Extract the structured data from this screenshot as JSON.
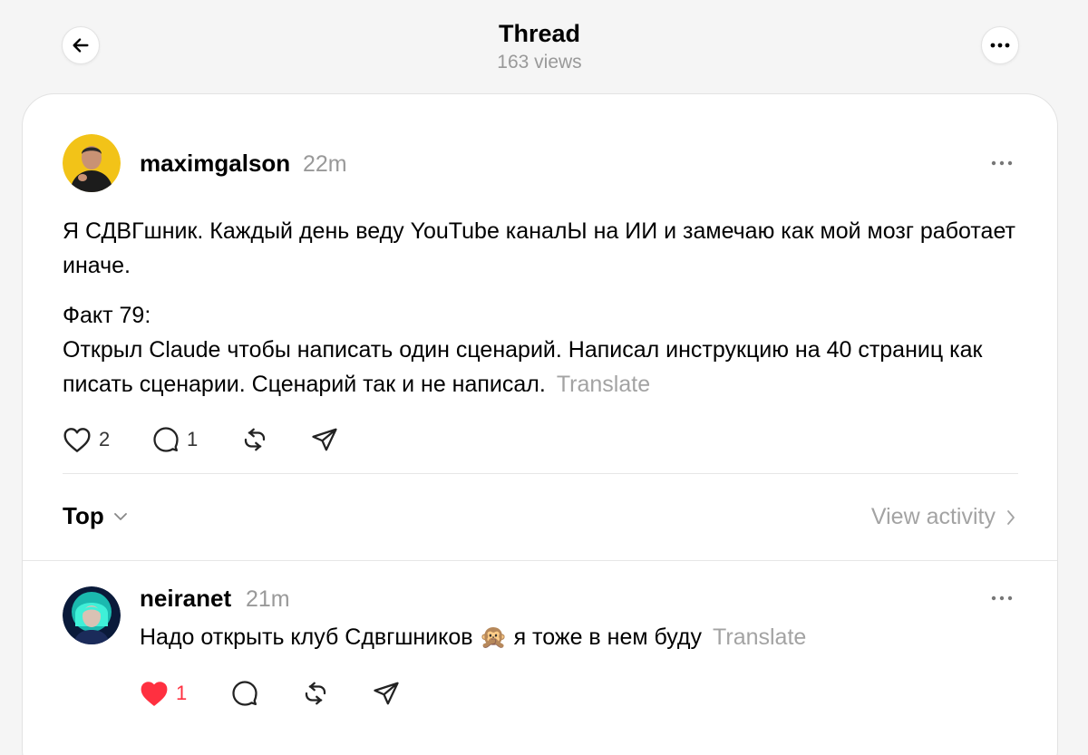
{
  "header": {
    "title": "Thread",
    "views": "163 views"
  },
  "post": {
    "username": "maximgalson",
    "time": "22m",
    "paragraph1": "Я СДВГшник. Каждый день веду YouTube каналЫ на ИИ и замечаю как мой мозг работает иначе.",
    "paragraph2_line1": "Факт 79:",
    "paragraph2_line2": "Открыл Claude чтобы написать один сценарий. Написал инструкцию на 40 страниц как писать сценарии. Сценарий так и не написал.",
    "translate": "Translate",
    "likes": "2",
    "replies": "1"
  },
  "sort": {
    "label": "Top",
    "view_activity": "View activity"
  },
  "reply": {
    "username": "neiranet",
    "time": "21m",
    "text": "Надо открыть клуб Сдвгшников 🙊 я тоже в нем буду",
    "translate": "Translate",
    "likes": "1",
    "liked": true
  },
  "colors": {
    "liked": "#ff3040",
    "muted": "#999999",
    "divider": "#e6e6e6"
  },
  "icons": [
    "back-arrow-icon",
    "more-icon",
    "heart-icon",
    "comment-icon",
    "repost-icon",
    "share-icon",
    "chevron-down-icon",
    "chevron-right-icon"
  ]
}
